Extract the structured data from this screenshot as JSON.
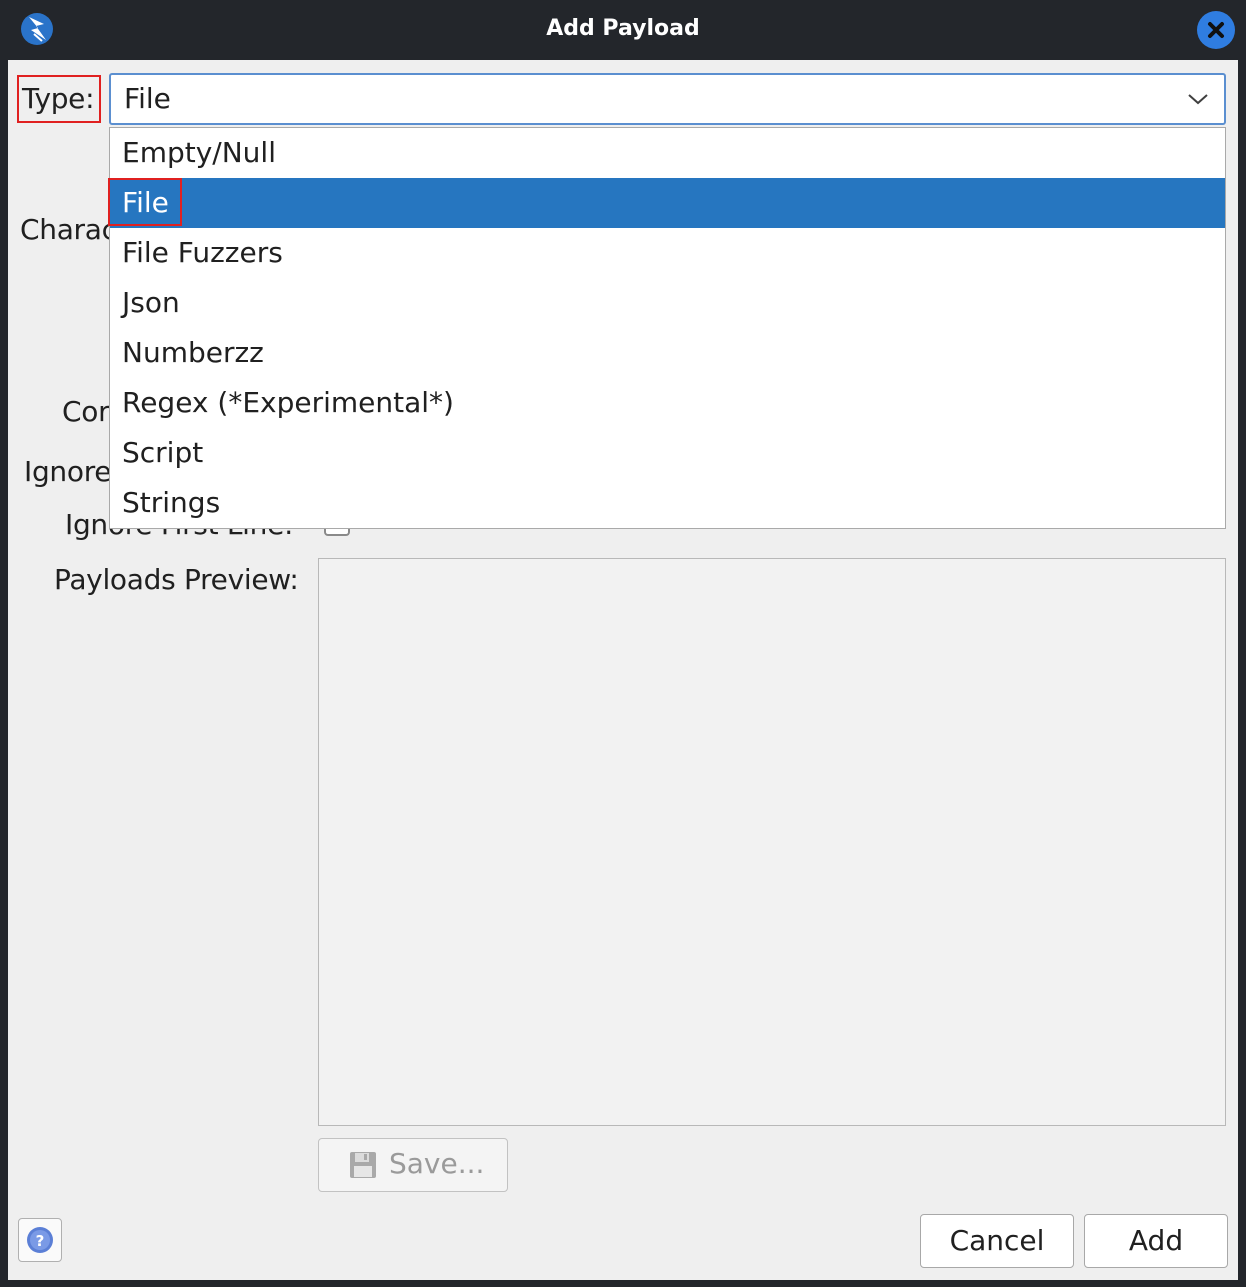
{
  "window": {
    "title": "Add Payload",
    "app_icon": "zap-lightning-icon",
    "close_icon": "close-icon"
  },
  "form": {
    "type_label": "Type:",
    "type_value": "File",
    "partial_labels": {
      "charset": "Charac",
      "comment": "Cor",
      "ignore_empty": "Ignore",
      "ignore_first_line": "Ignore First Line:"
    },
    "payloads_preview_label": "Payloads Preview:",
    "ignore_first_line_checked": false
  },
  "dropdown": {
    "options": [
      "Empty/Null",
      "File",
      "File Fuzzers",
      "Json",
      "Numberzz",
      "Regex (*Experimental*)",
      "Script",
      "Strings"
    ],
    "selected": "File"
  },
  "buttons": {
    "save": "Save...",
    "save_icon": "floppy-disk-icon",
    "help_icon": "help-icon",
    "cancel": "Cancel",
    "add": "Add"
  },
  "colors": {
    "selection": "#2676c0",
    "annotation_red": "#e02020",
    "close_button": "#2f7de1"
  }
}
